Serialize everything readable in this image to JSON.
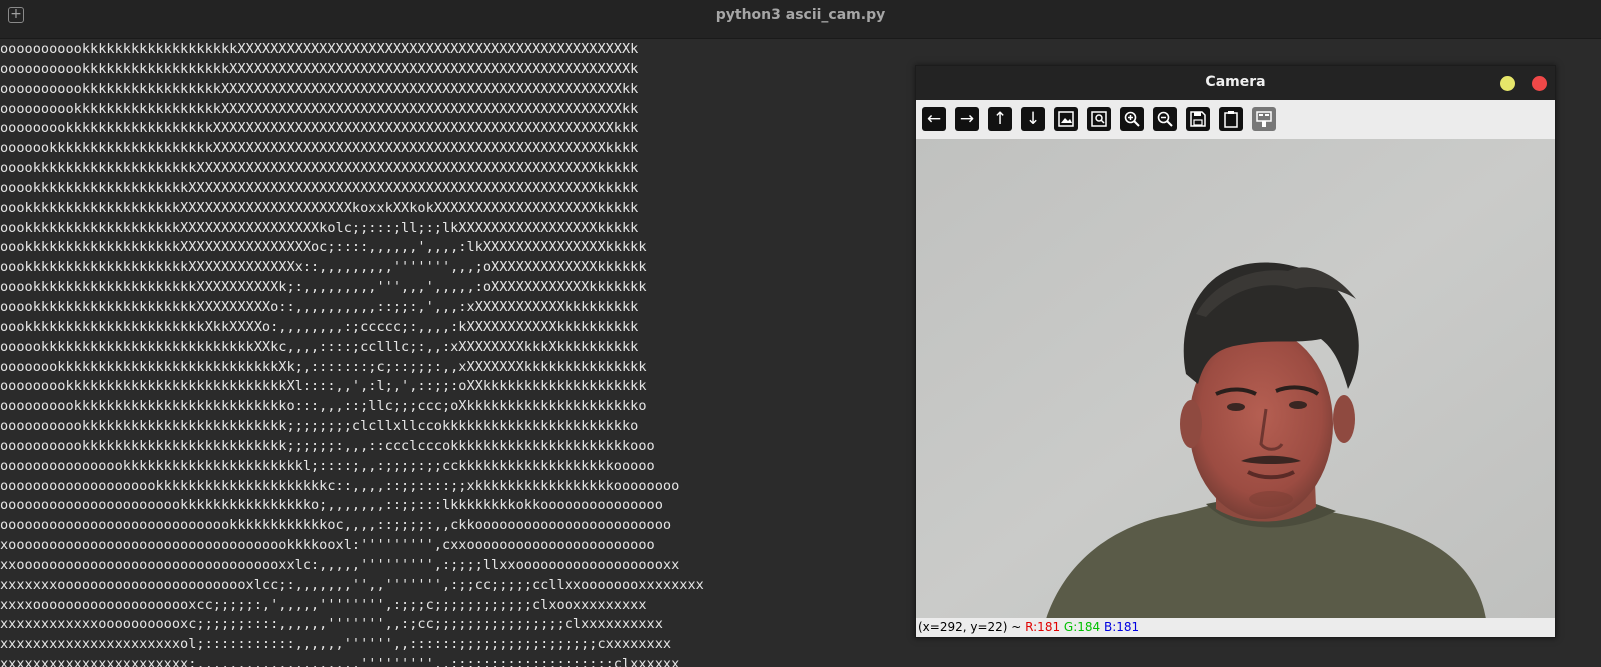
{
  "window": {
    "title": "python3 ascii_cam.py",
    "new_tab_icon": "plus-square-icon"
  },
  "terminal": {
    "lines": [
      "ooooooooookkkkkkkkkkkkkkkkkkkXXXXXXXXXXXXXXXXXXXXXXXXXXXXXXXXXXXXXXXXXXXXXXXXk",
      "ooooooooookkkkkkkkkkkkkkkkkkXXXXXXXXXXXXXXXXXXXXXXXXXXXXXXXXXXXXXXXXXXXXXXXXXk",
      "ooooooooookkkkkkkkkkkkkkkkkXXXXXXXXXXXXXXXXXXXXXXXXXXXXXXXXXXXXXXXXXXXXXXXXXkk",
      "oooooooookkkkkkkkkkkkkkkkkkXXXXXXXXXXXXXXXXXXXXXXXXXXXXXXXXXXXXXXXXXXXXXXXXXkk",
      "ooooooookkkkkkkkkkkkkkkkkkXXXXXXXXXXXXXXXXXXXXXXXXXXXXXXXXXXXXXXXXXXXXXXXXXkkk",
      "ooooookkkkkkkkkkkkkkkkkkkkXXXXXXXXXXXXXXXXXXXXXXXXXXXXXXXXXXXXXXXXXXXXXXXXkkkk",
      "ooookkkkkkkkkkkkkkkkkkkkXXXXXXXXXXXXXXXXXXXXXXXXXXXXXXXXXXXXXXXXXXXXXXXXXkkkkk",
      "ooookkkkkkkkkkkkkkkkkkkXXXXXXXXXXXXXXXXXXXXXXXXXXXXXXXXXXXXXXXXXXXXXXXXXXkkkkk",
      "oookkkkkkkkkkkkkkkkkkkXXXXXXXXXXXXXXXXXXXXXkoxxkXXkokXXXXXXXXXXXXXXXXXXXXkkkkk",
      "oookkkkkkkkkkkkkkkkkkkXXXXXXXXXXXXXXXXXkolc;;:::;ll;:;lkXXXXXXXXXXXXXXXXXkkkkk",
      "oookkkkkkkkkkkkkkkkkkkXXXXXXXXXXXXXXXXoc;::::,,,,,,',,,,:lkXXXXXXXXXXXXXXXkkkkk",
      "oookkkkkkkkkkkkkkkkkkkkXXXXXXXXXXXXXx::,,,,,,,,,''''''',,,;oXXXXXXXXXXXXXkkkkkk",
      "ooookkkkkkkkkkkkkkkkkkkkXXXXXXXXXXk;:,,,,,,,,,''',,,',,,,,:oXXXXXXXXXXXXkkkkkkk",
      "ooookkkkkkkkkkkkkkkkkkkkXXXXXXXXXo::,,,,,,,,,,::;;:,',,,:xXXXXXXXXXXXkkkkkkkkk",
      "oookkkkkkkkkkkkkkkkkkkkkkXkkXXXXo:,,,,,,,,:;ccccc;:,,,,:kXXXXXXXXXXXkkkkkkkkkk",
      "oooookkkkkkkkkkkkkkkkkkkkkkkkkkXXkc,,,,::::;cclllc;:,,:xXXXXXXXXkkkXkkkkkkkkkk",
      "oooooookkkkkkkkkkkkkkkkkkkkkkkkkkkXk;,:::::::;c;::;;;:,,xXXXXXXXkkkkkkkkkkkkkkk",
      "ooooooookkkkkkkkkkkkkkkkkkkkkkkkkkkXl::::,,',:l;,',::;;:oXXkkkkkkkkkkkkkkkkkkkk",
      "oooooooookkkkkkkkkkkkkkkkkkkkkkkkkko:::,,,::;llc;;;ccc;oXkkkkkkkkkkkkkkkkkkkkko",
      "ooooooooookkkkkkkkkkkkkkkkkkkkkkkkk;;;;;;;;clcllxllccokkkkkkkkkkkkkkkkkkkkkkko",
      "ooooooooookkkkkkkkkkkkkkkkkkkkkkkkk;;;;;;:,,,::ccclcccokkkkkkkkkkkkkkkkkkkkkkooo",
      "oooooooooooooookkkkkkkkkkkkkkkkkkkkkkl;::::;,,:;;;;:;;cckkkkkkkkkkkkkkkkkkkooooo",
      "oooooooooooooooooookkkkkkkkkkkkkkkkkkkkkc::,,,,::;;::::;;xkkkkkkkkkkkkkkkkkoooooooo",
      "ooooooooooooooooooooookkkkkkkkkkkkkkkko;,,,,,,,::;;:::lkkkkkkkkokkooooooooooooooo",
      "ooooooooooooooooooooooooooookkkkkkkkkkkkoc,,,,::;;;;:,,ckkoooooooooooooooooooooooo",
      "xooooooooooooooooooooooooooooooooookkkkooxl:''''''''',cxxooooooooooooooooooooooo",
      "xxooooooooooooooooooooooooooooooooxxlc:,,,,,''''''''',:;;;;llxxooooooooooooooooooxx",
      "xxxxxxxoooooooooooooooooooooooxlcc;:,,,,,,,'',,''''''',:;;cc;;;;;ccllxxoooooooxxxxxxxx",
      "xxxxoooooooooooooooooooxcc;;;;;:,',,,,,'''''''',:;;;c;;;;;;;;;;;;clxooxxxxxxxxx",
      "xxxxxxxxxxxxooooooooooxc;;;;;;::::,,,,,,''''''',,:;cc;;;;;;;;;;;;;;;;clxxxxxxxxxx",
      "xxxxxxxxxxxxxxxxxxxxxxol;:::::::::::,,,,,,'''''',,::::::;;;;;;;;;;:;;;;;;cxxxxxxxx",
      "xxxxxxxxxxxxxxxxxxxxxxx:,,,,,,,,,,,,,,,,,,,,''''''''',,:::::::::;;;;;;;;;;:clxxxxxx"
    ]
  },
  "camera_window": {
    "title": "Camera",
    "minimize_color": "#e6e66a",
    "close_color": "#f04848",
    "toolbar": [
      {
        "name": "pan-left-icon",
        "glyph": "←"
      },
      {
        "name": "pan-right-icon",
        "glyph": "→"
      },
      {
        "name": "pan-up-icon",
        "glyph": "↑"
      },
      {
        "name": "pan-down-icon",
        "glyph": "↓"
      },
      {
        "name": "zoom-in-100-icon",
        "glyph": "image"
      },
      {
        "name": "zoom-fit-icon",
        "glyph": "image-search"
      },
      {
        "name": "zoom-in-icon",
        "glyph": "zoom-in"
      },
      {
        "name": "zoom-out-icon",
        "glyph": "zoom-out"
      },
      {
        "name": "save-icon",
        "glyph": "save"
      },
      {
        "name": "copy-clipboard-icon",
        "glyph": "clipboard"
      },
      {
        "name": "properties-icon",
        "glyph": "settings"
      }
    ],
    "status": {
      "coords": "(x=292, y=22) ~ ",
      "r": "R:181",
      "g": "G:184",
      "b": "B:181"
    }
  }
}
